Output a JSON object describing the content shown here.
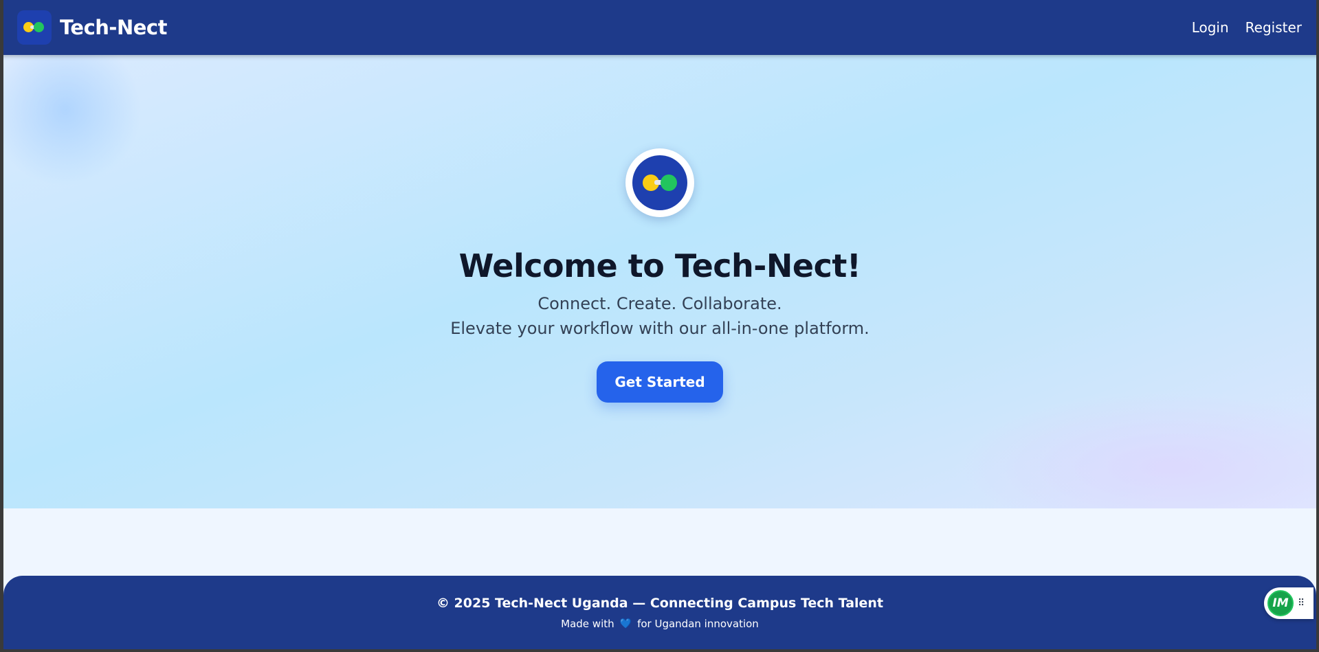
{
  "navbar": {
    "brand_name": "Tech-Nect",
    "links": [
      {
        "label": "Login"
      },
      {
        "label": "Register"
      }
    ]
  },
  "hero": {
    "title": "Welcome to Tech-Nect!",
    "tagline": "Connect. Create. Collaborate.",
    "subtitle": "Elevate your workflow with our all-in-one platform.",
    "cta_label": "Get Started"
  },
  "footer": {
    "copyright": "© 2025 Tech-Nect Uganda — Connecting Campus Tech Talent",
    "made_with_prefix": "Made with",
    "heart_icon": "💙",
    "made_with_suffix": "for Ugandan innovation"
  },
  "widget": {
    "badge_text": "IM",
    "grip_icon": "⠿"
  },
  "colors": {
    "navbar": "#1e3a8a",
    "accent": "#2563eb",
    "logo_yellow": "#facc15",
    "logo_green": "#22c55e"
  }
}
